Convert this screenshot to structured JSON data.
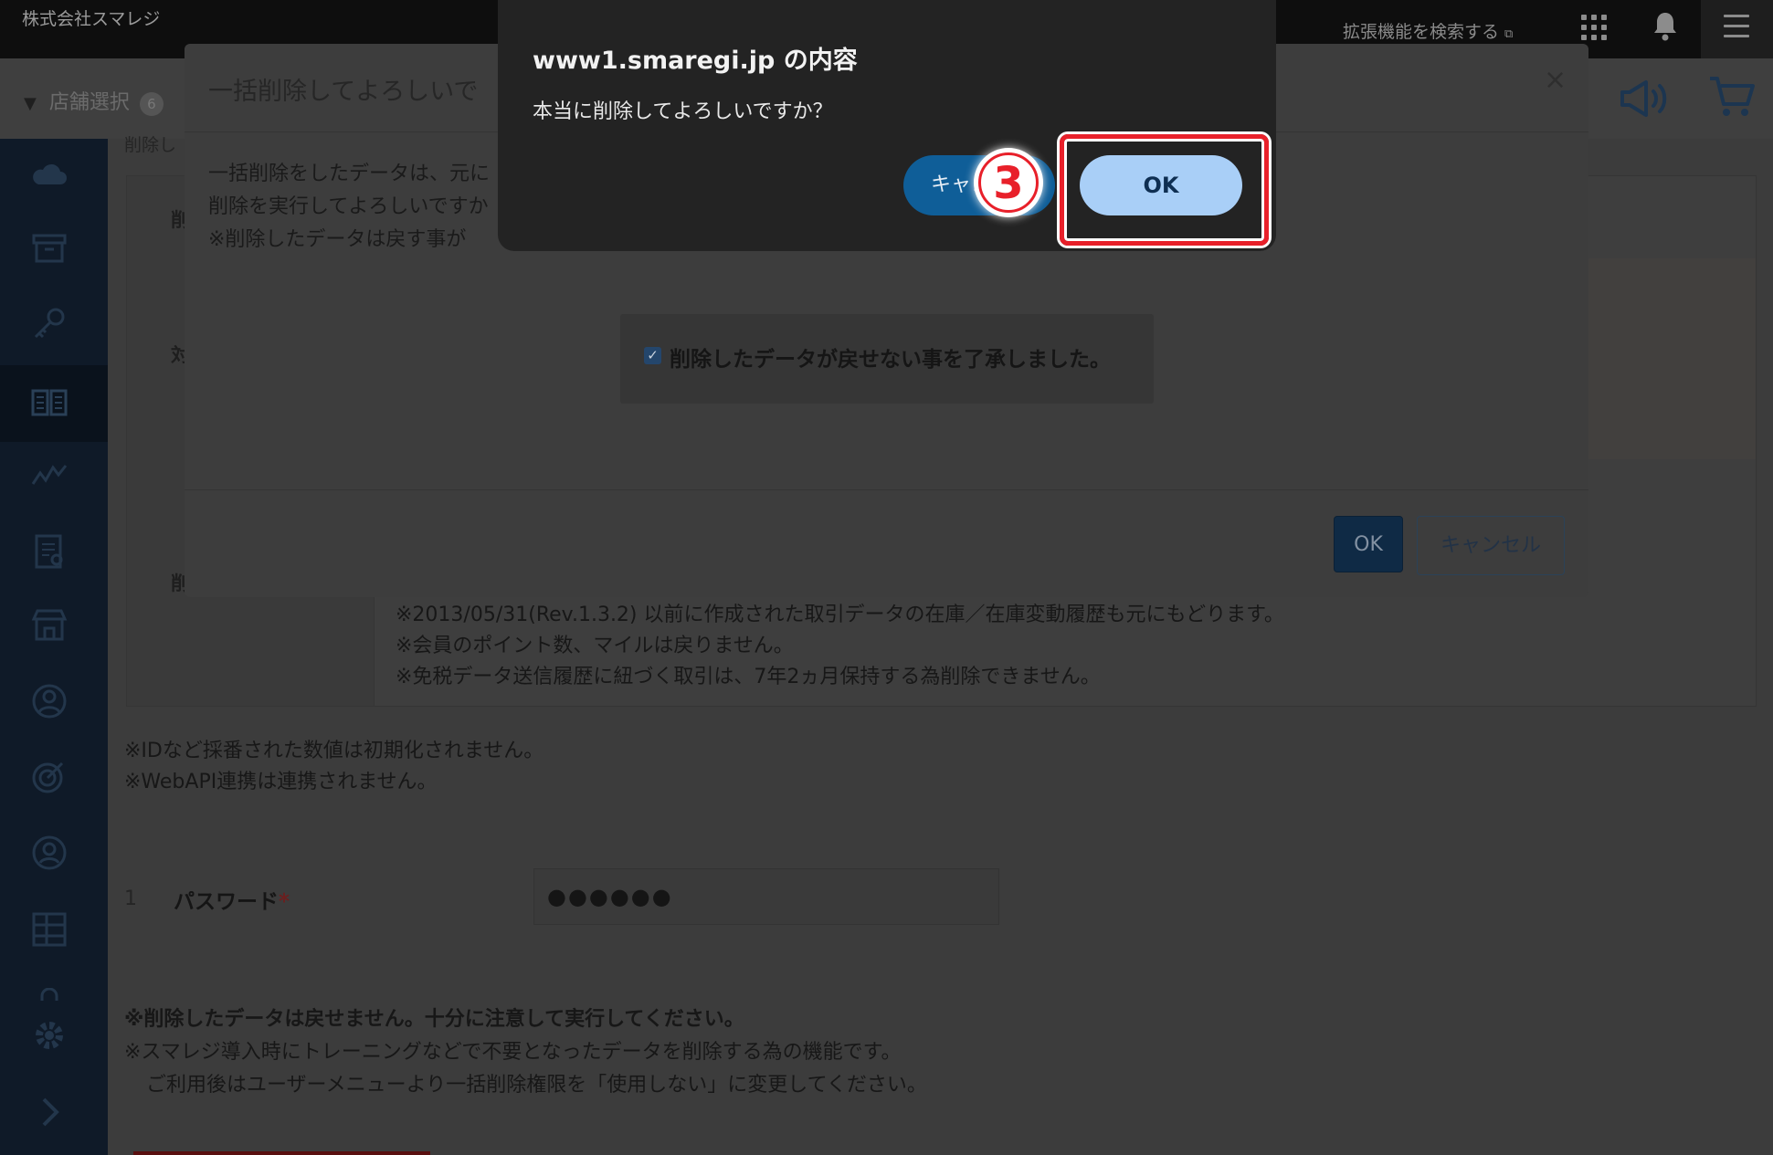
{
  "header": {
    "company": "株式会社スマレジ",
    "extension_search": "拡張機能を検索する",
    "external_glyph": "⧉"
  },
  "subheader": {
    "store_select": "店舗選択",
    "store_count": "6"
  },
  "sidebar": {
    "icons": [
      "cloud-icon",
      "archive-icon",
      "key-icon",
      "book-icon",
      "chart-icon",
      "report-icon",
      "store-icon",
      "user-icon",
      "target-icon",
      "member-icon",
      "grid-icon",
      "lock-icon",
      "gear-icon",
      "chevron-right-icon"
    ],
    "selected": "book-icon"
  },
  "page": {
    "breadcrumb": "削除し",
    "row_labels": [
      "削除",
      "対象",
      "削除"
    ],
    "table_notes": [
      "※2013/05/31(Rev.1.3.2) 以前に作成された取引データの在庫／在庫変動履歴も元にもどります。",
      "※会員のポイント数、マイルは戻りません。",
      "※免税データ送信履歴に紐づく取引は、7年2ヵ月保持する為削除できません。"
    ],
    "notes": [
      "※IDなど採番された数値は初期化されません。",
      "※WebAPI連携は連携されません。"
    ],
    "password": {
      "number": "1",
      "label": "パスワード",
      "required_mark": "*",
      "value": "●●●●●●"
    },
    "warnings": [
      "※削除したデータは戻せません。十分に注意して実行してください。",
      "※スマレジ導入時にトレーニングなどで不要となったデータを削除する為の機能です。",
      "ご利用後はユーザーメニューより一括削除権限を「使用しない」に変更してください。"
    ]
  },
  "bulk_modal": {
    "title": "一括削除してよろしいで",
    "close": "×",
    "lines": [
      "一括削除をしたデータは、元に",
      "削除を実行してよろしいですか",
      "※削除したデータは戻す事が"
    ],
    "acknowledge_checked": true,
    "acknowledge_label": "削除したデータが戻せない事を了承しました。",
    "ok_label": "OK",
    "cancel_label": "キャンセル"
  },
  "confirm_dialog": {
    "title": "www1.smaregi.jp の内容",
    "message": "本当に削除してよろしいですか？",
    "cancel_label": "キャンセル",
    "ok_label": "OK"
  },
  "annotation": {
    "step": "3",
    "highlight_color": "#e8202a"
  }
}
